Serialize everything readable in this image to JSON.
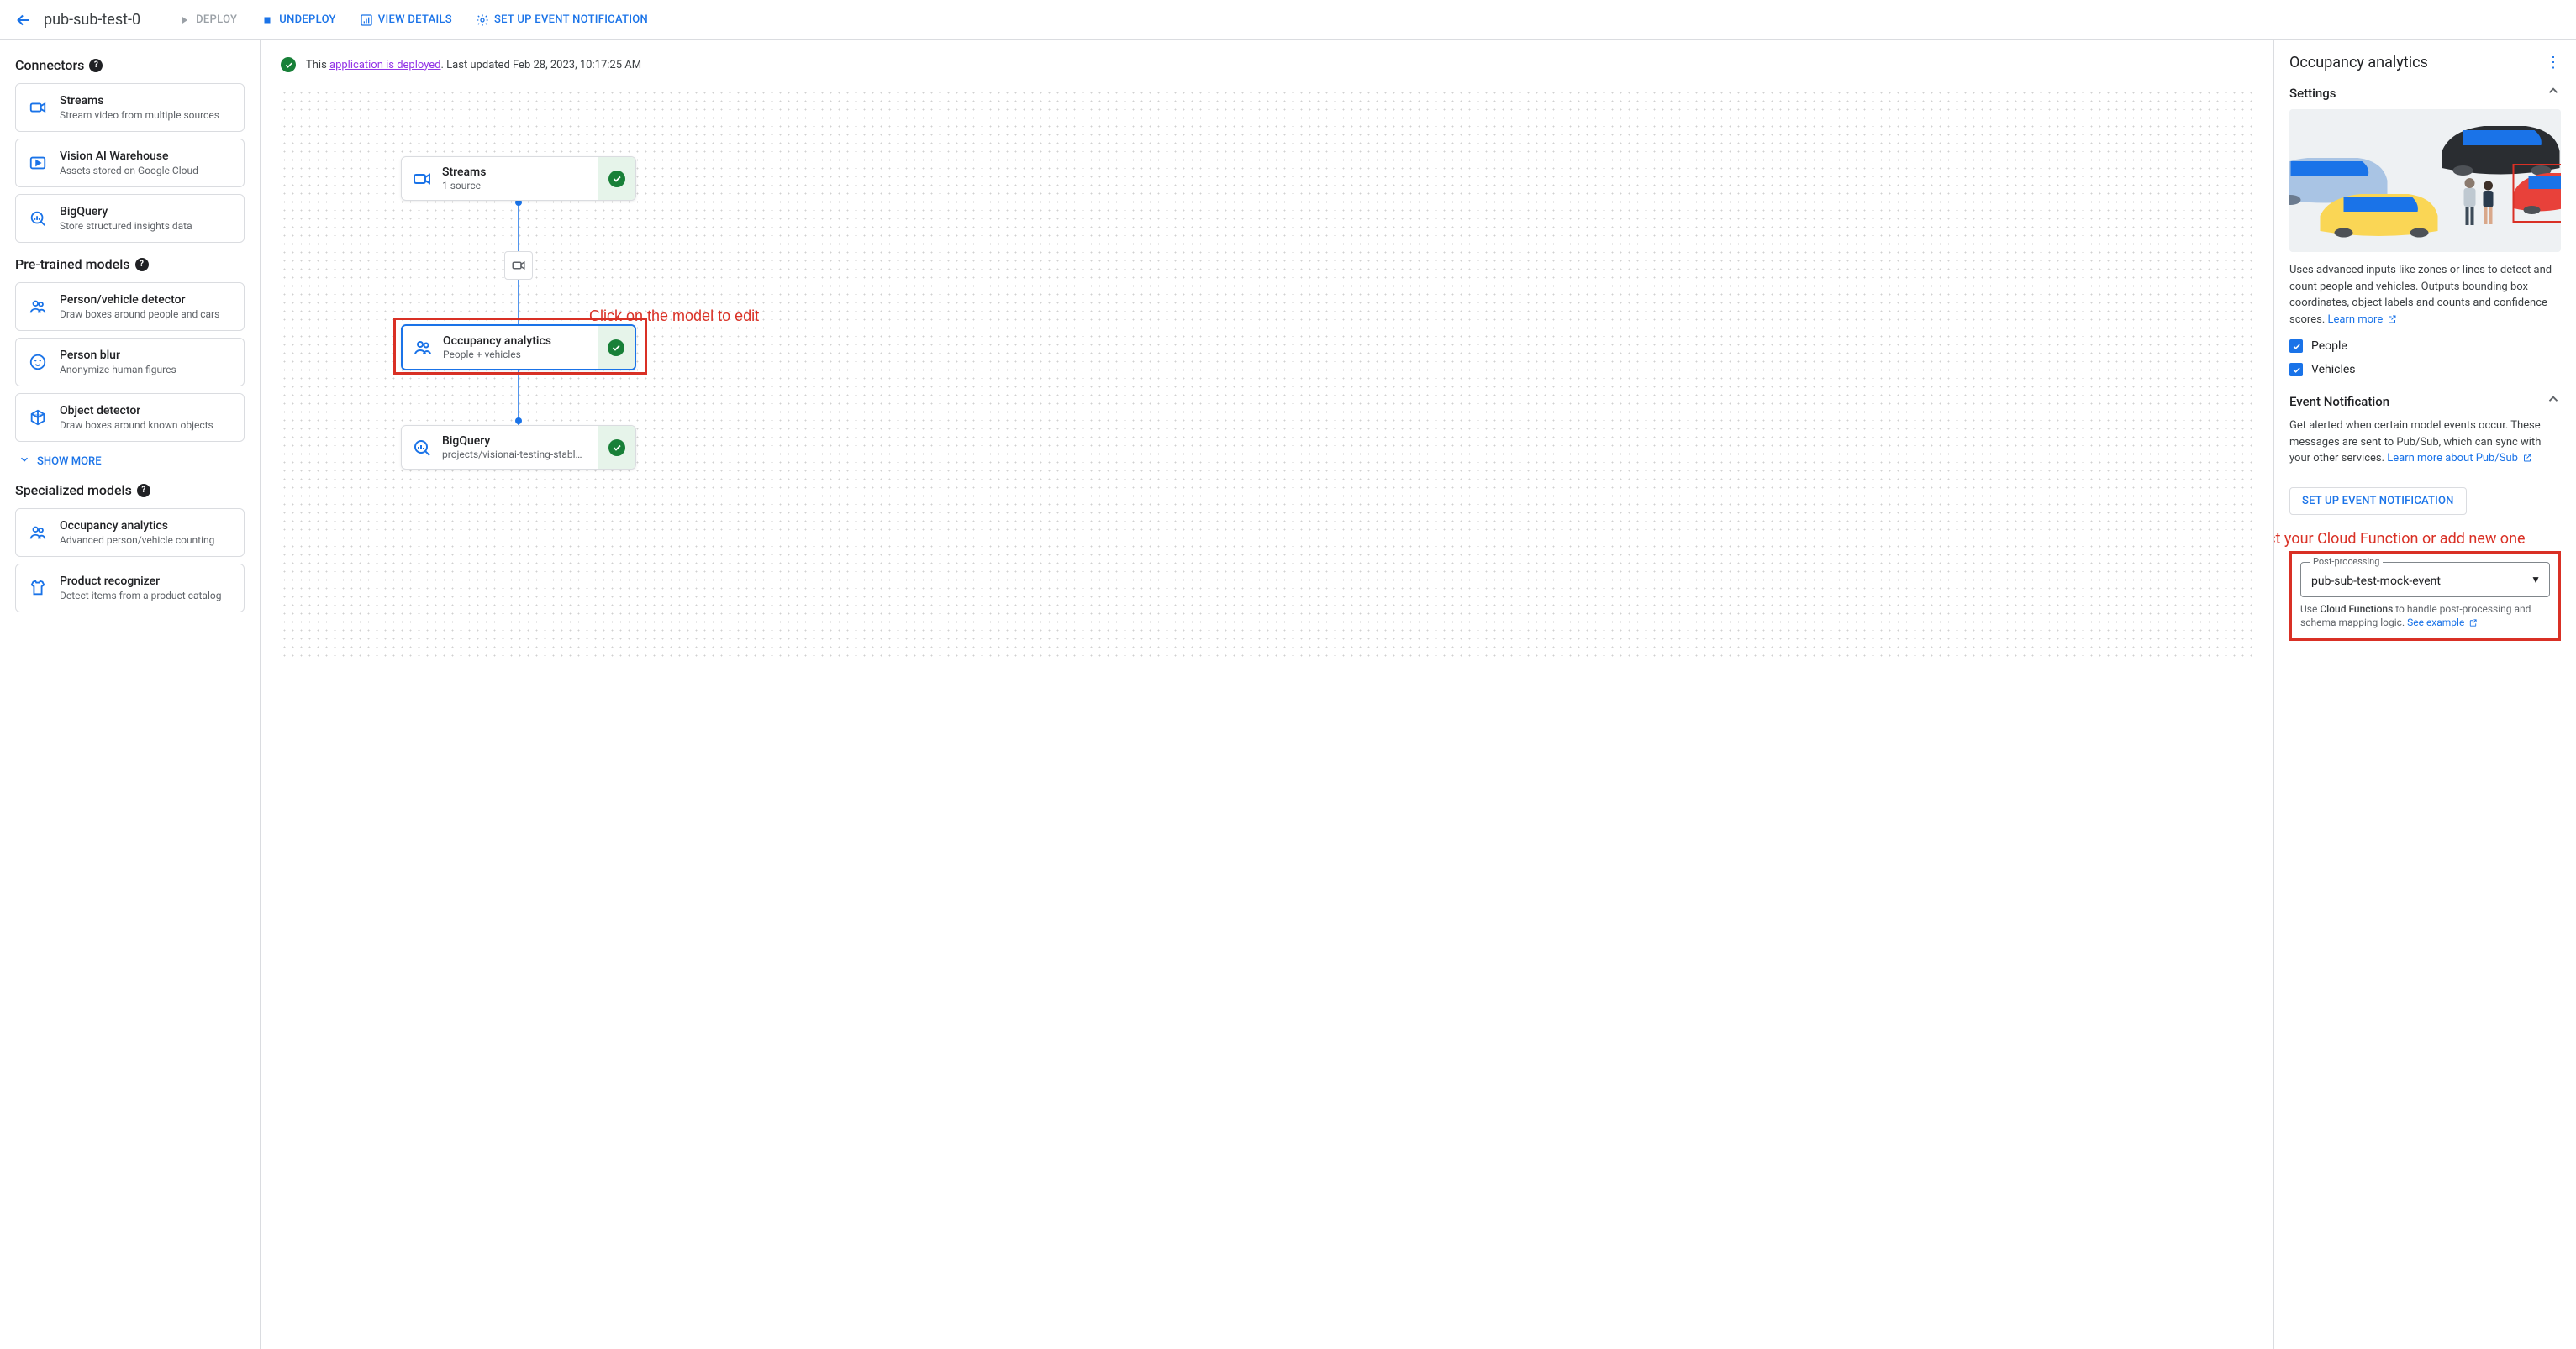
{
  "topbar": {
    "title": "pub-sub-test-0",
    "deploy": "DEPLOY",
    "undeploy": "UNDEPLOY",
    "viewDetails": "VIEW DETAILS",
    "setupNotif": "SET UP EVENT NOTIFICATION"
  },
  "sidebar": {
    "connectors": {
      "header": "Connectors",
      "items": [
        {
          "title": "Streams",
          "sub": "Stream video from multiple sources"
        },
        {
          "title": "Vision AI Warehouse",
          "sub": "Assets stored on Google Cloud"
        },
        {
          "title": "BigQuery",
          "sub": "Store structured insights data"
        }
      ]
    },
    "pretrained": {
      "header": "Pre-trained models",
      "items": [
        {
          "title": "Person/vehicle detector",
          "sub": "Draw boxes around people and cars"
        },
        {
          "title": "Person blur",
          "sub": "Anonymize human figures"
        },
        {
          "title": "Object detector",
          "sub": "Draw boxes around known objects"
        }
      ],
      "showMore": "SHOW MORE"
    },
    "specialized": {
      "header": "Specialized models",
      "items": [
        {
          "title": "Occupancy analytics",
          "sub": "Advanced person/vehicle counting"
        },
        {
          "title": "Product recognizer",
          "sub": "Detect items from a product catalog"
        }
      ]
    }
  },
  "canvas": {
    "status": {
      "prefix": "This ",
      "link": "application is deployed",
      "suffix": ". Last updated Feb 28, 2023, 10:17:25 AM"
    },
    "annotation1": "Click on the model to edit",
    "nodes": {
      "streams": {
        "title": "Streams",
        "sub": "1 source"
      },
      "occupancy": {
        "title": "Occupancy analytics",
        "sub": "People + vehicles"
      },
      "bigquery": {
        "title": "BigQuery",
        "sub": "projects/visionai-testing-stabl…"
      }
    }
  },
  "panel": {
    "title": "Occupancy analytics",
    "settings": {
      "header": "Settings",
      "desc": "Uses advanced inputs like zones or lines to detect and count people and vehicles. Outputs bounding box coordinates, object labels and counts and confidence scores. ",
      "learnMore": "Learn more",
      "checkPeople": "People",
      "checkVehicles": "Vehicles"
    },
    "event": {
      "header": "Event Notification",
      "desc": "Get alerted when certain model events occur. These messages are sent to Pub/Sub, which can sync with your other services. ",
      "learnMore": "Learn more about Pub/Sub",
      "button": "SET UP EVENT NOTIFICATION",
      "annotation": "Select your Cloud Function or add new one",
      "selectLabel": "Post-processing",
      "selectValue": "pub-sub-test-mock-event",
      "helperPrefix": "Use ",
      "helperStrong": "Cloud Functions",
      "helperSuffix": " to handle post-processing and schema mapping logic. ",
      "helperLink": "See example"
    }
  }
}
